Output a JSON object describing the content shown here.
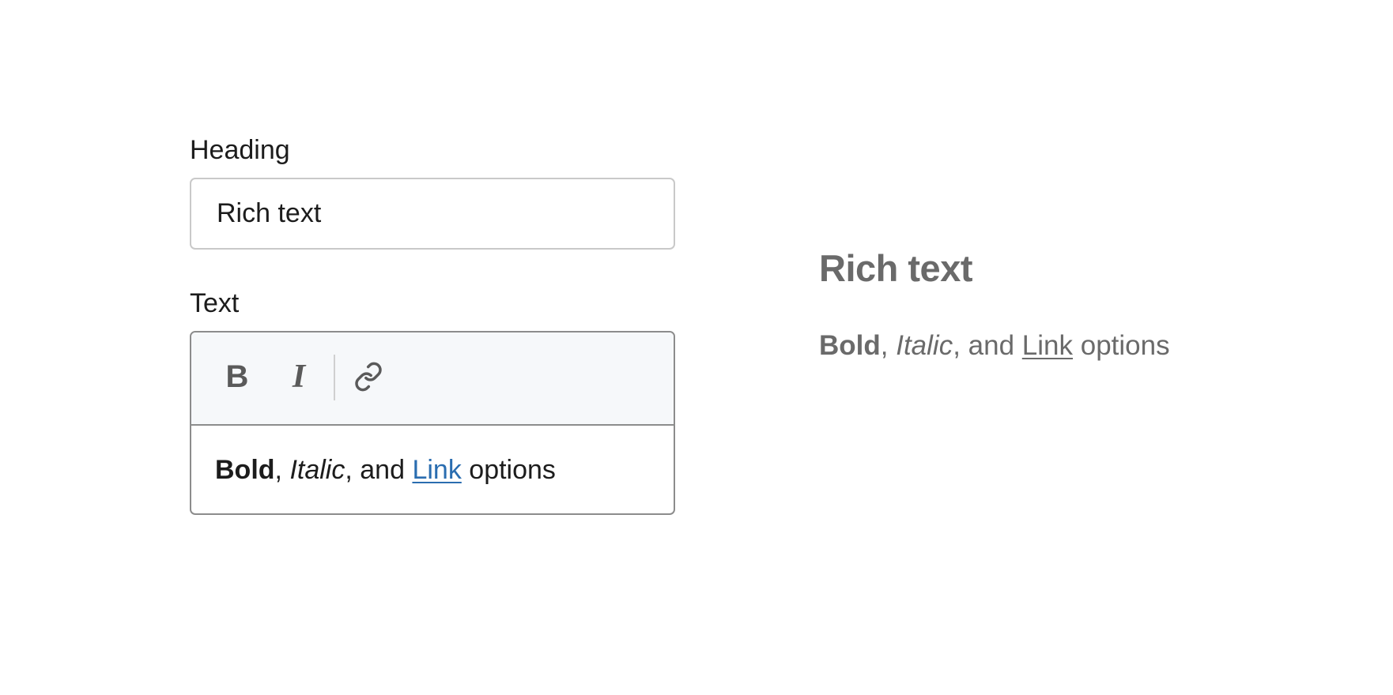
{
  "editor": {
    "heading_label": "Heading",
    "heading_value": "Rich text",
    "text_label": "Text",
    "toolbar": {
      "bold_label": "B",
      "italic_label": "I",
      "link_icon": "link-icon"
    },
    "content": {
      "bold": "Bold",
      "sep1": ",",
      "italic": "Italic",
      "sep2": ", and",
      "link": "Link",
      "tail": "options"
    }
  },
  "preview": {
    "heading": "Rich text",
    "body": {
      "bold": "Bold",
      "sep1": ",",
      "italic": "Italic",
      "sep2": ", and",
      "link": "Link",
      "tail": "options"
    }
  },
  "colors": {
    "link": "#2a6db0",
    "preview_text": "#6a6a6a",
    "toolbar_bg": "#f6f8fa",
    "border": "#8c8c8c"
  }
}
